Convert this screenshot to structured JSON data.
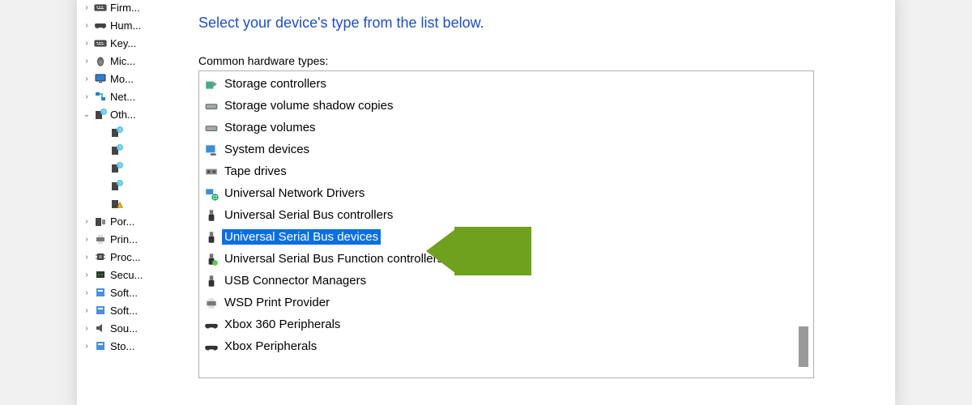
{
  "sidebar": {
    "items": [
      {
        "label": "Firm...",
        "expand": "right",
        "icon": "keyboard"
      },
      {
        "label": "Hum...",
        "expand": "right",
        "icon": "game"
      },
      {
        "label": "Key...",
        "expand": "right",
        "icon": "keyboard"
      },
      {
        "label": "Mic...",
        "expand": "right",
        "icon": "mouse"
      },
      {
        "label": "Mo...",
        "expand": "right",
        "icon": "monitor"
      },
      {
        "label": "Net...",
        "expand": "right",
        "icon": "network"
      },
      {
        "label": "Oth...",
        "expand": "down",
        "icon": "unknown"
      },
      {
        "label": "",
        "expand": "none",
        "icon": "unknown",
        "child": true
      },
      {
        "label": "",
        "expand": "none",
        "icon": "unknown",
        "child": true
      },
      {
        "label": "",
        "expand": "none",
        "icon": "unknown",
        "child": true
      },
      {
        "label": "",
        "expand": "none",
        "icon": "unknown",
        "child": true
      },
      {
        "label": "",
        "expand": "none",
        "icon": "unknown-warn",
        "child": true
      },
      {
        "label": "Por...",
        "expand": "right",
        "icon": "port"
      },
      {
        "label": "Prin...",
        "expand": "right",
        "icon": "printer"
      },
      {
        "label": "Proc...",
        "expand": "right",
        "icon": "cpu"
      },
      {
        "label": "Secu...",
        "expand": "right",
        "icon": "security"
      },
      {
        "label": "Soft...",
        "expand": "right",
        "icon": "software"
      },
      {
        "label": "Soft...",
        "expand": "right",
        "icon": "software"
      },
      {
        "label": "Sou...",
        "expand": "right",
        "icon": "sound"
      },
      {
        "label": "Sto...",
        "expand": "right",
        "icon": "software"
      }
    ]
  },
  "heading": "Select your device's type from the list below.",
  "list_label": "Common hardware types:",
  "hw": {
    "items": [
      {
        "label": "Storage controllers",
        "icon": "storage-ctrl"
      },
      {
        "label": "Storage volume shadow copies",
        "icon": "drive"
      },
      {
        "label": "Storage volumes",
        "icon": "drive"
      },
      {
        "label": "System devices",
        "icon": "system"
      },
      {
        "label": "Tape drives",
        "icon": "tape"
      },
      {
        "label": "Universal Network Drivers",
        "icon": "net-drv"
      },
      {
        "label": "Universal Serial Bus controllers",
        "icon": "usb"
      },
      {
        "label": "Universal Serial Bus devices",
        "icon": "usb",
        "selected": true
      },
      {
        "label": "Universal Serial Bus Function controllers",
        "icon": "usb-fn"
      },
      {
        "label": "USB Connector Managers",
        "icon": "usb"
      },
      {
        "label": "WSD Print Provider",
        "icon": "printer"
      },
      {
        "label": "Xbox 360 Peripherals",
        "icon": "xbox"
      },
      {
        "label": "Xbox Peripherals",
        "icon": "xbox"
      }
    ]
  },
  "colors": {
    "selected_bg": "#0a6fe0",
    "arrow": "#6fa01e",
    "heading": "#1e4fbf"
  }
}
